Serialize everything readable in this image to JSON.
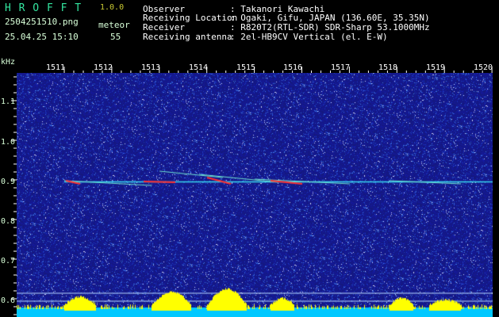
{
  "app": {
    "name": "H R O F F T",
    "version": "1.0.0"
  },
  "file": {
    "name": "2504251510.png",
    "datetime": "25.04.25 15:10"
  },
  "counter": {
    "label": "meteor",
    "value": "55"
  },
  "info": [
    {
      "key": "Observer",
      "value": ": Takanori Kawachi"
    },
    {
      "key": "Receiving Location",
      "value": ": Ogaki, Gifu, JAPAN (136.60E, 35.35N)"
    },
    {
      "key": "Receiver",
      "value": ": R820T2(RTL-SDR) SDR-Sharp 53.1000MHz"
    },
    {
      "key": "Receiving antenna",
      "value": ": 2el-HB9CV Vertical (el. E-W)"
    }
  ],
  "axis": {
    "y_unit": "kHz",
    "y_ticks": [
      "1.1",
      "1.0",
      "0.9",
      "0.8",
      "0.7",
      "0.6"
    ],
    "x_ticks": [
      "1511",
      "1512",
      "1513",
      "1514",
      "1515",
      "1516",
      "1517",
      "1518",
      "1519",
      "1520"
    ]
  },
  "colors": {
    "background": "#000000",
    "waterfall": "#1a1f8c",
    "carrier": "#38d8f0",
    "echo_hot": "#ff3030",
    "level_bar": "#ffff00",
    "baseline": "#00c8ff"
  }
}
